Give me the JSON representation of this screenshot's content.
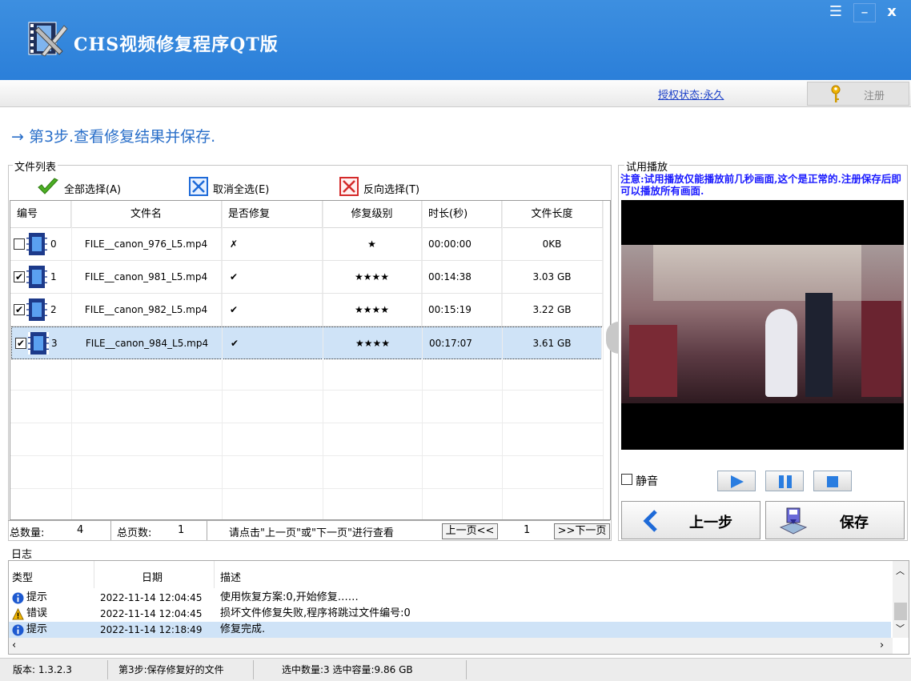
{
  "app": {
    "title": "CHS视频修复程序QT版"
  },
  "window_controls": {
    "menu": "☰",
    "minimize": "–",
    "close": "x"
  },
  "auth": {
    "status": "授权状态:永久",
    "register_label": "注册"
  },
  "step": {
    "title": "→ 第3步.查看修复结果并保存."
  },
  "file_list": {
    "group_label": "文件列表",
    "select_all": "全部选择(A)",
    "deselect_all": "取消全选(E)",
    "invert": "反向选择(T)",
    "columns": [
      "编号",
      "文件名",
      "是否修复",
      "修复级别",
      "时长(秒)",
      "文件长度"
    ],
    "rows": [
      {
        "checked": "",
        "id": "0",
        "name": "FILE__canon_976_L5.mp4",
        "repaired": "✗",
        "level": "★",
        "duration": "00:00:00",
        "size": "0KB"
      },
      {
        "checked": "✔",
        "id": "1",
        "name": "FILE__canon_981_L5.mp4",
        "repaired": "✔",
        "level": "★★★★",
        "duration": "00:14:38",
        "size": "3.03 GB"
      },
      {
        "checked": "✔",
        "id": "2",
        "name": "FILE__canon_982_L5.mp4",
        "repaired": "✔",
        "level": "★★★★",
        "duration": "00:15:19",
        "size": "3.22 GB"
      },
      {
        "checked": "✔",
        "id": "3",
        "name": "FILE__canon_984_L5.mp4",
        "repaired": "✔",
        "level": "★★★★",
        "duration": "00:17:07",
        "size": "3.61 GB"
      }
    ],
    "footer": {
      "total_label": "总数量:",
      "total_value": "4",
      "pages_label": "总页数:",
      "pages_value": "1",
      "hint": "请点击\"上一页\"或\"下一页\"进行查看",
      "prev": "上一页<<",
      "page": "1",
      "next": ">>下一页"
    }
  },
  "preview": {
    "group_label": "试用播放",
    "note": "注意:试用播放仅能播放前几秒画面,这个是正常的.注册保存后即可以播放所有画面.",
    "mute": "静音",
    "back_label": "上一步",
    "save_label": "保存"
  },
  "log": {
    "group_label": "日志",
    "columns": [
      "类型",
      "日期",
      "描述"
    ],
    "rows": [
      {
        "type": "提示",
        "date": "2022-11-14 12:04:45",
        "desc": "使用恢复方案:0,开始修复……"
      },
      {
        "type": "错误",
        "date": "2022-11-14 12:04:45",
        "desc": "损坏文件修复失败,程序将跳过文件编号:0"
      },
      {
        "type": "提示",
        "date": "2022-11-14 12:18:49",
        "desc": "修复完成."
      }
    ]
  },
  "status": {
    "version": "版本:  1.3.2.3",
    "step": "第3步:保存修复好的文件",
    "selection": "选中数量:3 选中容量:9.86 GB"
  },
  "colors": {
    "title_bar": "#2b7fd9",
    "accent": "#2a6fc9",
    "note": "#1a1aff"
  }
}
